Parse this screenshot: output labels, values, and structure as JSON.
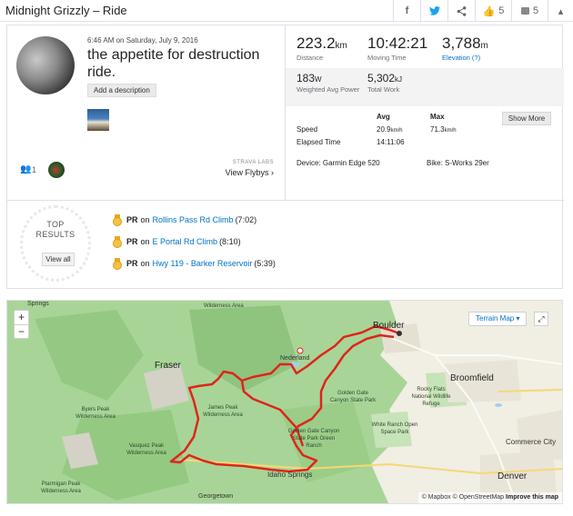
{
  "header": {
    "title": "Midnight Grizzly – Ride",
    "kudos_count": "5",
    "comment_count": "5"
  },
  "activity": {
    "date": "6:46 AM on Saturday, July 9, 2016",
    "name": "the appetite for destruction ride.",
    "add_description": "Add a description",
    "kudos_count": "1",
    "strava_labs": "STRAVA LABS",
    "view_flybys": "View Flybys ›"
  },
  "stats": {
    "distance": "223.2",
    "distance_unit": "km",
    "distance_label": "Distance",
    "moving_time": "10:42:21",
    "moving_time_label": "Moving Time",
    "elevation": "3,788",
    "elevation_unit": "m",
    "elevation_label": "Elevation (?)",
    "weighted_power": "183",
    "weighted_power_unit": "W",
    "weighted_power_label": "Weighted Avg Power",
    "total_work": "5,302",
    "total_work_unit": "kJ",
    "total_work_label": "Total Work"
  },
  "table": {
    "avg_header": "Avg",
    "max_header": "Max",
    "speed_label": "Speed",
    "speed_avg": "20.9",
    "speed_avg_unit": "km/h",
    "speed_max": "71.3",
    "speed_max_unit": "km/h",
    "elapsed_label": "Elapsed Time",
    "elapsed_value": "14:11:06",
    "show_more": "Show More",
    "device": "Device: Garmin Edge 520",
    "bike": "Bike: S-Works 29er"
  },
  "top_results": {
    "heading_line1": "TOP",
    "heading_line2": "RESULTS",
    "view_all": "View all",
    "items": [
      {
        "badge": "PR",
        "on": "on",
        "segment": "Rollins Pass Rd Climb",
        "time": "(7:02)"
      },
      {
        "badge": "PR",
        "on": "on",
        "segment": "E Portal Rd Climb",
        "time": "(8:10)"
      },
      {
        "badge": "PR",
        "on": "on",
        "segment": "Hwy 119 - Barker Reservoir",
        "time": "(5:39)"
      }
    ]
  },
  "map": {
    "terrain_button": "Terrain Map ▾",
    "zoom_in": "+",
    "zoom_out": "−",
    "attribution_mapbox": "© Mapbox",
    "attribution_osm": "© OpenStreetMap",
    "improve": "Improve this map",
    "labels": {
      "boulder": "Boulder",
      "broomfield": "Broomfield",
      "denver": "Denver",
      "commerce_city": "Commerce City",
      "fraser": "Fraser",
      "nederland": "Nederland",
      "idaho_springs": "Idaho Springs",
      "georgetown": "Georgetown",
      "rocky_flats": "Rocky Flats National Wildlife Refuge",
      "golden_gate": "Golden Gate Canyon State Park",
      "white_ranch": "White Ranch Open Space Park",
      "james_peak": "James Peak Wilderness Area",
      "vasquez": "Vasquez Peak Wilderness Area",
      "byers": "Byers Peak Wilderness Area",
      "ptarmigan": "Ptarmigan Peak Wilderness Area",
      "golden_gate_ranch": "Golden Gate Canyon State Park Green Ranch",
      "springs": "Springs",
      "wilderness_top": "Wilderness Area"
    }
  },
  "colors": {
    "accent_link": "#0072c6",
    "route": "#e0241b",
    "medal": "#f5c342",
    "forest": "#9ecf8a"
  }
}
